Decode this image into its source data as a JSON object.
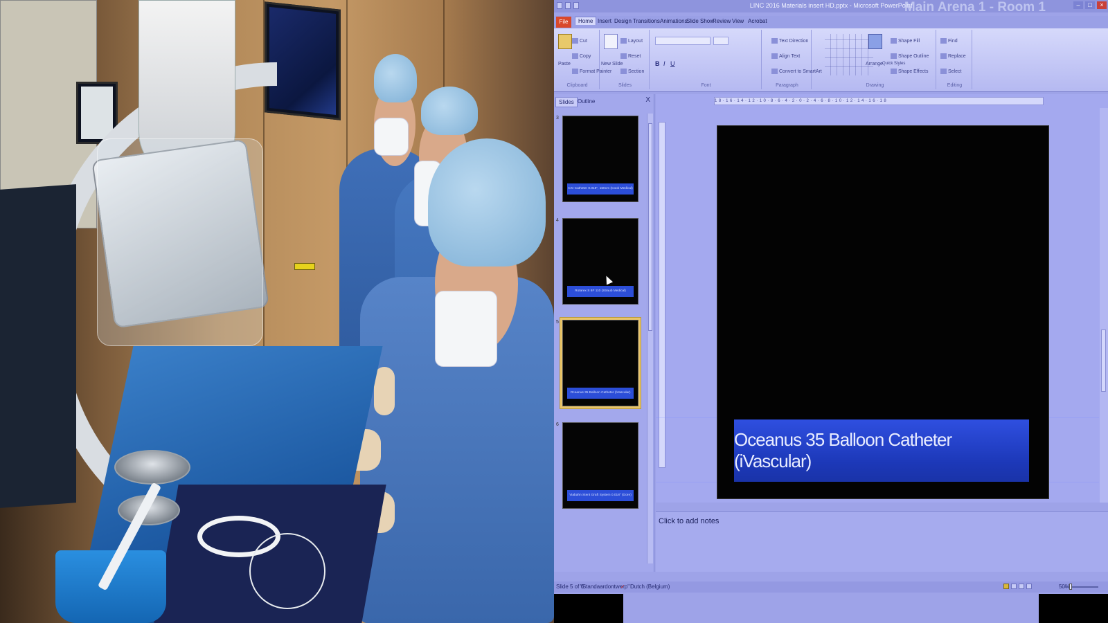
{
  "window": {
    "title": "LINC 2016 Materials insert HD.pptx - Microsoft PowerPoint",
    "overlay_text": "Main Arena 1 - Room 1"
  },
  "ribbon_tabs": [
    "File",
    "Home",
    "Insert",
    "Design",
    "Transitions",
    "Animations",
    "Slide Show",
    "Review",
    "View",
    "Acrobat"
  ],
  "ribbon": {
    "clipboard": {
      "label": "Clipboard",
      "paste": "Paste",
      "cut": "Cut",
      "copy": "Copy",
      "format_painter": "Format Painter"
    },
    "slides": {
      "label": "Slides",
      "new_slide": "New Slide",
      "layout": "Layout",
      "reset": "Reset",
      "section": "Section"
    },
    "font": {
      "label": "Font"
    },
    "paragraph": {
      "label": "Paragraph",
      "text_direction": "Text Direction",
      "align_text": "Align Text",
      "convert_smartart": "Convert to SmartArt"
    },
    "drawing": {
      "label": "Drawing",
      "arrange": "Arrange",
      "quick_styles": "Quick Styles",
      "shape_fill": "Shape Fill",
      "shape_outline": "Shape Outline",
      "shape_effects": "Shape Effects"
    },
    "editing": {
      "label": "Editing",
      "find": "Find",
      "replace": "Replace",
      "select": "Select"
    }
  },
  "panel": {
    "tab_slides": "Slides",
    "tab_outline": "Outline",
    "close": "X",
    "thumbnails": [
      {
        "number": "3",
        "caption": "CXI Catheter 0.018\", 150cm (Cook Medical)"
      },
      {
        "number": "4",
        "caption": "Rotarex S 6F 110 (Straub Medical)"
      },
      {
        "number": "5",
        "caption": "Oceanus 35 Balloon Catheter (iVascular)"
      },
      {
        "number": "6",
        "caption": "Viabahn Stent Graft System 0.018\" (Gore)"
      }
    ]
  },
  "slide": {
    "title": "Oceanus 35 Balloon Catheter (iVascular)"
  },
  "notes": {
    "placeholder": "Click to add notes"
  },
  "statusbar": {
    "slide_info": "Slide 5 of 6",
    "theme": "\"Standaardontwerp\"",
    "language": "Dutch (Belgium)",
    "zoom": "50%"
  },
  "ruler": {
    "marks": "18·16·14·12·10·8·6·4·2·0·2·4·6·8·10·12·14·16·18"
  }
}
